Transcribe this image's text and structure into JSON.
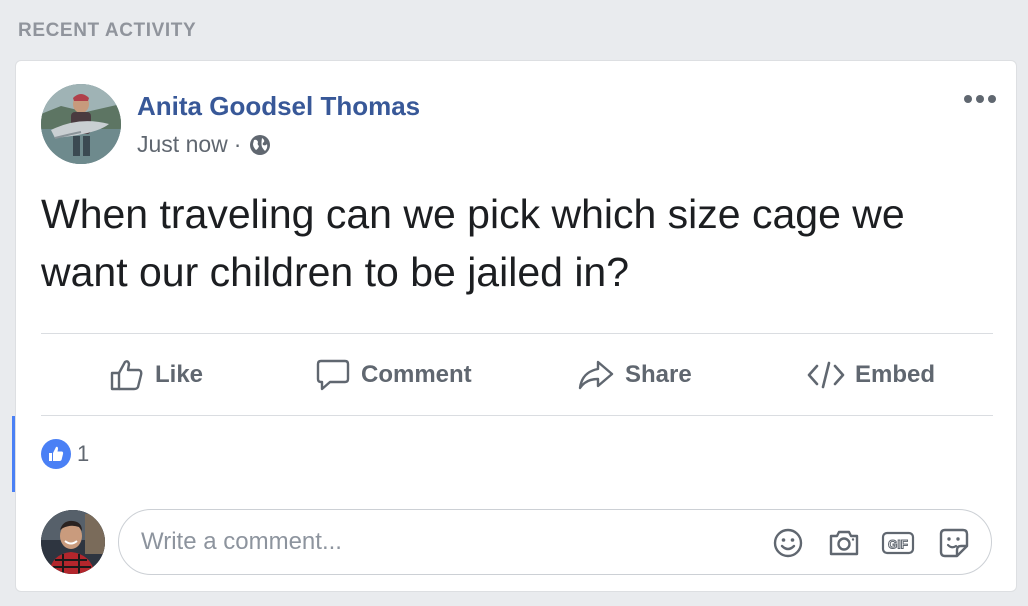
{
  "section": {
    "title": "RECENT ACTIVITY"
  },
  "post": {
    "author": "Anita Goodsel Thomas",
    "timestamp": "Just now",
    "separator": "·",
    "privacy_icon": "globe-icon",
    "menu_icon": "more-dots-icon",
    "text": "When traveling can we pick which size cage we want our children to be jailed in?"
  },
  "actions": {
    "like": "Like",
    "comment": "Comment",
    "share": "Share",
    "embed": "Embed"
  },
  "reactions": {
    "icon": "thumbs-up-icon",
    "count": "1"
  },
  "comment_composer": {
    "placeholder": "Write a comment...",
    "icons": [
      "emoji-icon",
      "camera-icon",
      "gif-icon",
      "sticker-icon"
    ]
  },
  "colors": {
    "page_bg": "#e9ebee",
    "author_link": "#385898",
    "action_text": "#606770",
    "like_blue": "#4a80f5"
  }
}
